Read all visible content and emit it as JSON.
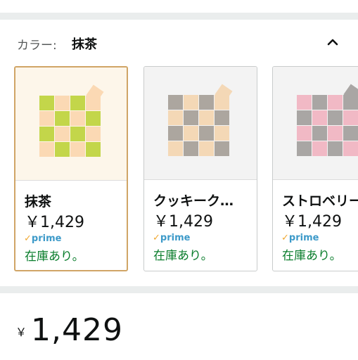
{
  "color_selector": {
    "label": "カラー:",
    "selected_value": "抹茶",
    "collapse_icon": "chevron-up-icon"
  },
  "cards": [
    {
      "name": "抹茶",
      "price": "￥1,429",
      "prime": "prime",
      "stock": "在庫あり。",
      "selected": true,
      "colors": {
        "a": "#c3d64a",
        "b": "#fbd9b4"
      }
    },
    {
      "name": "クッキーク…",
      "price": "￥1,429",
      "prime": "prime",
      "stock": "在庫あり。",
      "selected": false,
      "colors": {
        "a": "#aca69f",
        "b": "#f4d8b6"
      }
    },
    {
      "name": "ストロベリー",
      "price": "￥1,429",
      "prime": "prime",
      "stock": "在庫あり。",
      "selected": false,
      "colors": {
        "a": "#f1b9c5",
        "b": "#a9a6a4"
      }
    }
  ],
  "main_price": {
    "currency": "￥",
    "amount": "1,429"
  },
  "colors": {
    "selected_border": "#d0a566",
    "stock_green": "#0a7d2c",
    "prime_blue": "#3d9ac9",
    "divider_band": "#eaeded"
  }
}
